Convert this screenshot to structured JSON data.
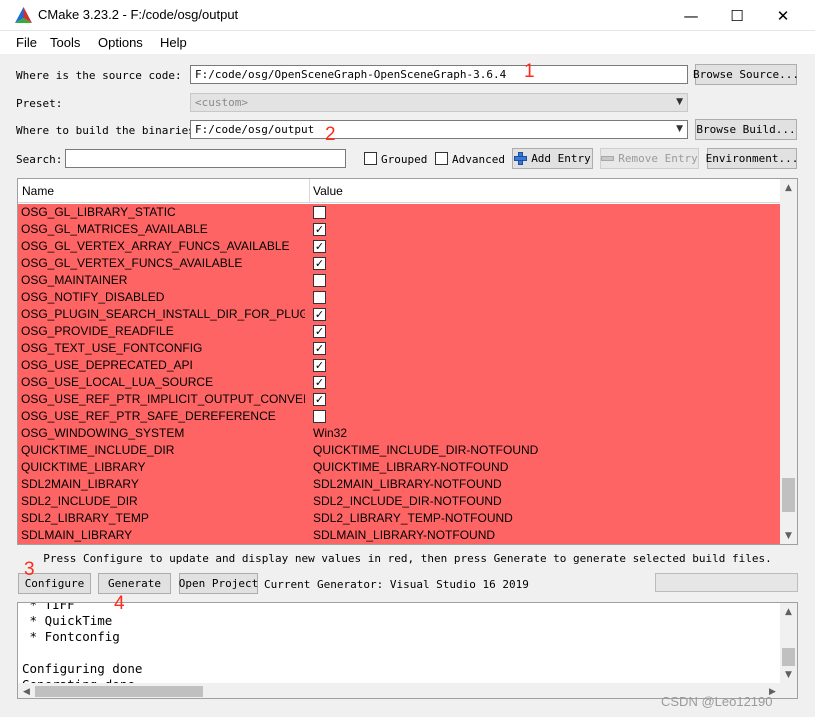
{
  "window": {
    "title": "CMake 3.23.2 - F:/code/osg/output",
    "minimize": "—",
    "maximize": "☐",
    "close": "✕"
  },
  "menu": [
    "File",
    "Tools",
    "Options",
    "Help"
  ],
  "source": {
    "label": "Where is the source code:",
    "value": "F:/code/osg/OpenSceneGraph-OpenSceneGraph-3.6.4",
    "browse": "Browse Source..."
  },
  "preset": {
    "label": "Preset:",
    "value": "<custom>"
  },
  "build": {
    "label": "Where to build the binaries:",
    "value": "F:/code/osg/output",
    "browse": "Browse Build..."
  },
  "search": {
    "label": "Search:",
    "value": "",
    "grouped": "Grouped",
    "advanced": "Advanced",
    "add_entry": "Add Entry",
    "remove_entry": "Remove Entry",
    "environment": "Environment..."
  },
  "table": {
    "col_name": "Name",
    "col_value": "Value",
    "rows": [
      {
        "name": "OSG_GL_LIBRARY_STATIC",
        "check": false
      },
      {
        "name": "OSG_GL_MATRICES_AVAILABLE",
        "check": true
      },
      {
        "name": "OSG_GL_VERTEX_ARRAY_FUNCS_AVAILABLE",
        "check": true
      },
      {
        "name": "OSG_GL_VERTEX_FUNCS_AVAILABLE",
        "check": true
      },
      {
        "name": "OSG_MAINTAINER",
        "check": false
      },
      {
        "name": "OSG_NOTIFY_DISABLED",
        "check": false
      },
      {
        "name": "OSG_PLUGIN_SEARCH_INSTALL_DIR_FOR_PLUG...",
        "check": true
      },
      {
        "name": "OSG_PROVIDE_READFILE",
        "check": true
      },
      {
        "name": "OSG_TEXT_USE_FONTCONFIG",
        "check": true
      },
      {
        "name": "OSG_USE_DEPRECATED_API",
        "check": true
      },
      {
        "name": "OSG_USE_LOCAL_LUA_SOURCE",
        "check": true
      },
      {
        "name": "OSG_USE_REF_PTR_IMPLICIT_OUTPUT_CONVER...",
        "check": true
      },
      {
        "name": "OSG_USE_REF_PTR_SAFE_DEREFERENCE",
        "check": false
      },
      {
        "name": "OSG_WINDOWING_SYSTEM",
        "value": "Win32"
      },
      {
        "name": "QUICKTIME_INCLUDE_DIR",
        "value": "QUICKTIME_INCLUDE_DIR-NOTFOUND"
      },
      {
        "name": "QUICKTIME_LIBRARY",
        "value": "QUICKTIME_LIBRARY-NOTFOUND"
      },
      {
        "name": "SDL2MAIN_LIBRARY",
        "value": "SDL2MAIN_LIBRARY-NOTFOUND"
      },
      {
        "name": "SDL2_INCLUDE_DIR",
        "value": "SDL2_INCLUDE_DIR-NOTFOUND"
      },
      {
        "name": "SDL2_LIBRARY_TEMP",
        "value": "SDL2_LIBRARY_TEMP-NOTFOUND"
      },
      {
        "name": "SDLMAIN_LIBRARY",
        "value": "SDLMAIN_LIBRARY-NOTFOUND"
      }
    ],
    "scroll_position": 0.95
  },
  "hint": "Press Configure to update and display new values in red, then press Generate to generate selected build files.",
  "actions": {
    "configure": "Configure",
    "generate": "Generate",
    "open_project": "Open Project",
    "generator": "Current Generator: Visual Studio 16 2019"
  },
  "output_lines": [
    " * TIFF",
    " * QuickTime",
    " * Fontconfig",
    "",
    "Configuring done",
    "Generating done"
  ],
  "annotations": [
    "1",
    "2",
    "3",
    "4"
  ],
  "watermark": "CSDN @Leo12190",
  "colors": {
    "changed_row": "#ff6464",
    "annotation": "#ff2a1a"
  }
}
